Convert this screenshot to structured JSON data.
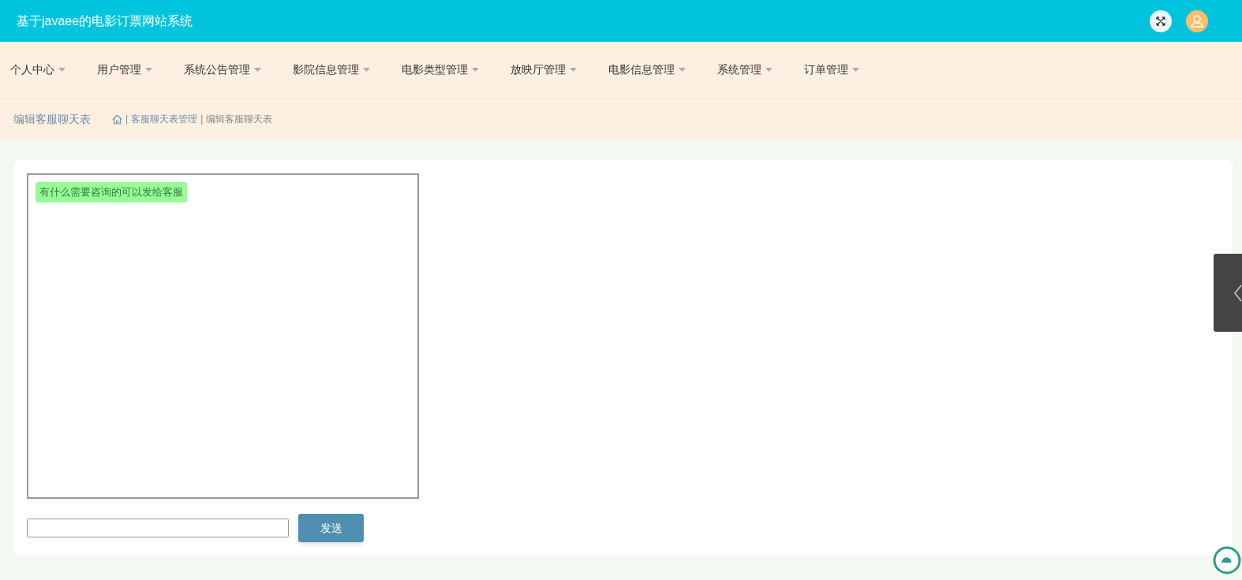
{
  "header": {
    "title": "基于javaee的电影订票网站系统"
  },
  "menu": [
    {
      "label": "个人中心"
    },
    {
      "label": "用户管理"
    },
    {
      "label": "系统公告管理"
    },
    {
      "label": "影院信息管理"
    },
    {
      "label": "电影类型管理"
    },
    {
      "label": "放映厅管理"
    },
    {
      "label": "电影信息管理"
    },
    {
      "label": "系统管理"
    },
    {
      "label": "订单管理"
    }
  ],
  "page_title": "编辑客服聊天表",
  "breadcrumb": {
    "separator": "|",
    "items": [
      "客服聊天表管理",
      "编辑客服聊天表"
    ]
  },
  "chat": {
    "messages": [
      "有什么需要咨询的可以发给客服"
    ],
    "send_button": "发送"
  }
}
